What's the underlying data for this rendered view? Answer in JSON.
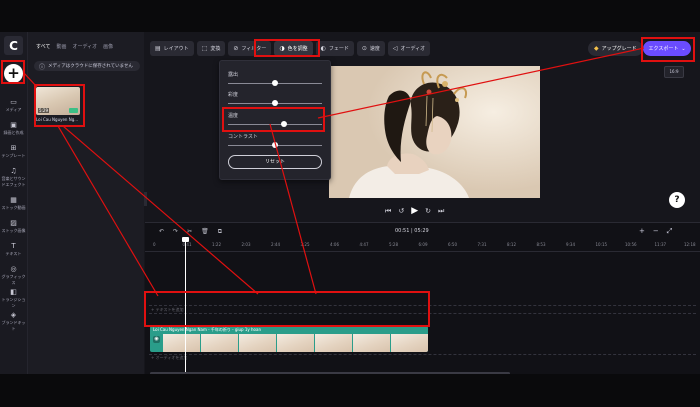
{
  "app": {
    "logo_letter": "C"
  },
  "rail": {
    "items": [
      {
        "icon": "media-icon",
        "glyph": "▭",
        "label": "メディア"
      },
      {
        "icon": "record-icon",
        "glyph": "▣",
        "label": "録画と作成"
      },
      {
        "icon": "template-icon",
        "glyph": "⊞",
        "label": "テンプレート"
      },
      {
        "icon": "music-icon",
        "glyph": "♫",
        "label": "音楽とサウンドエフェクト"
      },
      {
        "icon": "stock-video-icon",
        "glyph": "▦",
        "label": "ストック動画"
      },
      {
        "icon": "stock-image-icon",
        "glyph": "▨",
        "label": "ストック画像"
      },
      {
        "icon": "text-icon",
        "glyph": "T",
        "label": "テキスト"
      },
      {
        "icon": "graphics-icon",
        "glyph": "◎",
        "label": "グラフィックス"
      },
      {
        "icon": "transition-icon",
        "glyph": "◧",
        "label": "トランジション"
      },
      {
        "icon": "brand-kit-icon",
        "glyph": "◈",
        "label": "ブランドキット"
      }
    ]
  },
  "panel": {
    "tabs": [
      "すべて",
      "動画",
      "オーディオ",
      "画像"
    ],
    "cloud_banner": "メディアはクラウドに保存されていません",
    "media_item": {
      "name": "Loi Cau Nguyen Ng...",
      "duration": "5:29"
    }
  },
  "toolbar": {
    "buttons": [
      {
        "icon": "layout-icon",
        "glyph": "▤",
        "label": "レイアウト"
      },
      {
        "icon": "transform-icon",
        "glyph": "⬚",
        "label": "変換"
      },
      {
        "icon": "filter-icon",
        "glyph": "⊘",
        "label": "フィルター"
      },
      {
        "icon": "color-adjust-icon",
        "glyph": "◑",
        "label": "色を調整"
      },
      {
        "icon": "fade-icon",
        "glyph": "◐",
        "label": "フェード"
      },
      {
        "icon": "speed-icon",
        "glyph": "⊙",
        "label": "速度"
      },
      {
        "icon": "audio-icon",
        "glyph": "◁",
        "label": "オーディオ"
      }
    ],
    "upgrade_label": "アップグレード",
    "export_label": "エクスポート"
  },
  "aspect_ratio": "16:9",
  "color_panel": {
    "sliders": [
      {
        "label": "露出",
        "value": 0.5
      },
      {
        "label": "彩度",
        "value": 0.5
      },
      {
        "label": "温度",
        "value": 0.6
      },
      {
        "label": "コントラスト",
        "value": 0.5
      }
    ],
    "reset_label": "リセット"
  },
  "player": {
    "controls": [
      "⏮",
      "↺",
      "▶",
      "↻",
      "⏭"
    ]
  },
  "timeline": {
    "current_time": "00:51",
    "total_time": "05:29",
    "tools": [
      "↶",
      "↷",
      "✂",
      "🗑",
      "⧉"
    ],
    "zoom": [
      "+",
      "−",
      "⤢"
    ],
    "ticks": [
      "0",
      "0:41",
      "1:22",
      "2:03",
      "2:44",
      "3:25",
      "4:06",
      "4:47",
      "5:28",
      "6:09",
      "6:50",
      "7:31",
      "8:12",
      "8:53",
      "9:34",
      "10:15",
      "10:56",
      "11:37",
      "12:18"
    ],
    "text_track": "+ テキストを追加",
    "clip_title": "Loi Cau Nguyen Ngan Nam - 千年の祈り - giup 1y hoan",
    "audio_track": "+ オーディオを追加"
  },
  "colors": {
    "accent": "#6a4cff",
    "highlight": "#e01010",
    "clip": "#2a9d8a"
  }
}
